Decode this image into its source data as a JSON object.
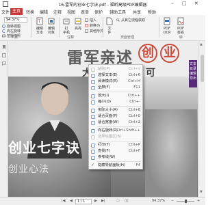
{
  "window": {
    "title": "16.雷军的创业七字诀.pdf - 福昕高级PDF编辑器",
    "min_glyph": "–",
    "max_glyph": "□",
    "close_glyph": "✕"
  },
  "menu": {
    "tabs": [
      "文件",
      "主页",
      "转换",
      "编辑",
      "注释",
      "视图",
      "表单",
      "保护",
      "辅助工具",
      "共享",
      "帮助"
    ],
    "active_index": 1,
    "accent": "#c83a3a"
  },
  "ribbon": {
    "zoom_value": "94.37%",
    "small_items": [
      "旋转视图",
      "向左旋转",
      "拍摄快照"
    ],
    "buttons": [
      {
        "label": "编辑\n文本",
        "icon": "edit-text-icon"
      },
      {
        "label": "编辑\n对象",
        "icon": "edit-object-icon"
      },
      {
        "label": "打\n字机",
        "icon": "typewriter-icon"
      },
      {
        "label": "高亮",
        "icon": "highlight-icon"
      },
      {
        "label": "文\n件",
        "icon": "file-icon"
      },
      {
        "label": "PDF\nOCR",
        "icon": "ocr-icon"
      },
      {
        "label": "PDF\n签名",
        "icon": "sign-icon"
      }
    ],
    "small_right": [
      "插入",
      "转换为",
      "其他形式"
    ],
    "search_label": "从其它流程获取",
    "groups": [
      "工具",
      "注释",
      "页面管理",
      "转"
    ]
  },
  "document": {
    "headline": "雷军亲述",
    "circled": [
      "创",
      "业"
    ],
    "subline": "大创业路径 / 可",
    "big_title": "创业七字诀",
    "sub_title": "创业心法",
    "panel_text": "文本 目录 编辑 导出"
  },
  "context_menu": {
    "items": [
      {
        "label": "粘贴(P)",
        "key": "Ctrl+V",
        "disabled": true,
        "icon": "paste-icon"
      },
      {
        "label": "选择文本(E)",
        "key": "Ctrl+6",
        "icon": "select-text-icon"
      },
      {
        "label": "阅读模式(R)",
        "key": "Ctrl+H",
        "icon": "reading-mode-icon"
      },
      {
        "label": "全屏(F)",
        "key": "F11",
        "icon": "fullscreen-icon"
      },
      {
        "sep": true
      },
      {
        "label": "放大(I)",
        "key": "Ctrl++",
        "icon": "zoom-in-icon"
      },
      {
        "label": "缩小(O)",
        "key": "Ctrl+-",
        "icon": "zoom-out-icon"
      },
      {
        "sep": true
      },
      {
        "label": "实际大小(A)",
        "key": "Ctrl+8",
        "icon": "actual-size-icon"
      },
      {
        "label": "适合页面(P)",
        "key": "Ctrl+0",
        "icon": "fit-page-icon"
      },
      {
        "label": "适合宽度(W)",
        "key": "Ctrl+2",
        "icon": "fit-width-icon"
      },
      {
        "sep": true
      },
      {
        "label": "向右旋转(R)",
        "key": "Ctrl+Shift++",
        "icon": "rotate-right-icon"
      },
      {
        "label": "选择绘图区(B)",
        "key": "",
        "icon": "select-area-icon",
        "disabled": true
      },
      {
        "sep": true
      },
      {
        "label": "打印(T)",
        "key": "Ctrl+P",
        "icon": "print-icon"
      },
      {
        "label": "查找(F)",
        "key": "Ctrl+F",
        "icon": "find-icon"
      },
      {
        "label": "参考线(W)",
        "key": "",
        "icon": "guides-icon"
      },
      {
        "sep": true
      },
      {
        "label": "隐藏导航面板(H)",
        "key": "F4",
        "icon": "",
        "checked": true
      }
    ]
  },
  "status": {
    "page_box": "1 / 1",
    "zoom_value": "94.37%"
  }
}
